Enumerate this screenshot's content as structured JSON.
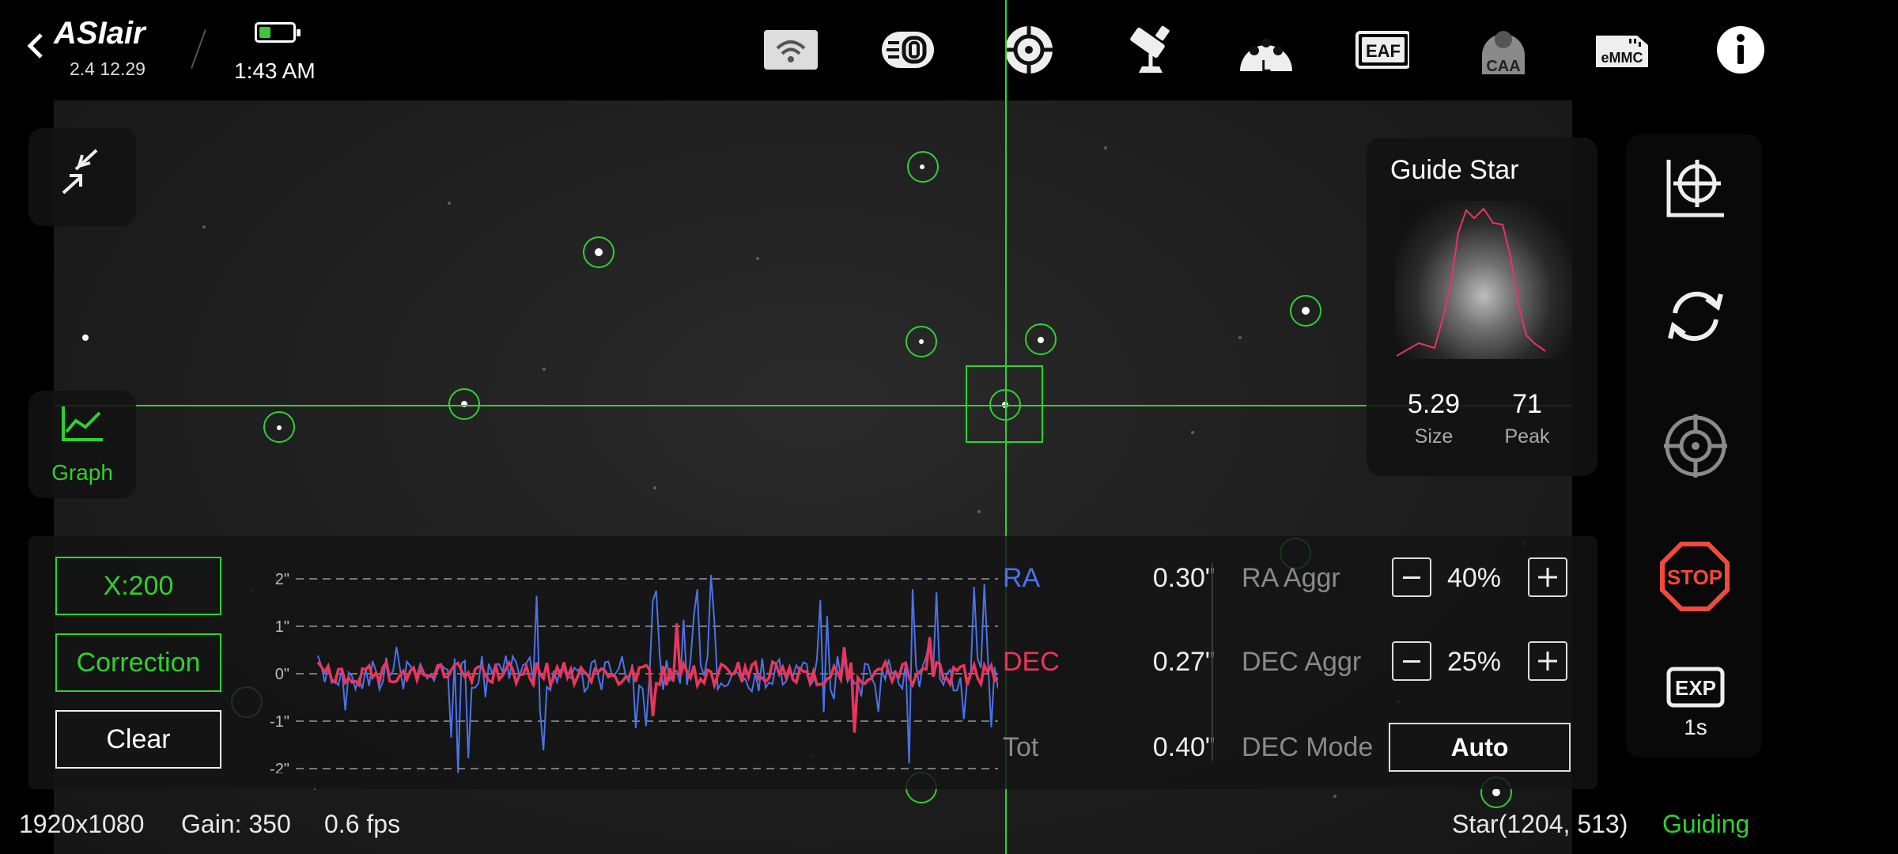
{
  "app": {
    "logo": "ASIair",
    "version": "2.4 12.29",
    "time": "1:43 AM"
  },
  "topbar": {
    "icons": [
      "wifi-icon",
      "storage-icon",
      "guide-target-icon",
      "telescope-icon",
      "filter-wheel-icon",
      "eaf-icon",
      "caa-icon",
      "emmc-icon",
      "info-icon"
    ],
    "eaf_label": "EAF",
    "caa_label": "CAA",
    "emmc_label": "eMMC",
    "filter_label": "L"
  },
  "left": {
    "graph_label": "Graph"
  },
  "guide_star": {
    "title": "Guide Star",
    "size_value": "5.29",
    "size_label": "Size",
    "peak_value": "71",
    "peak_label": "Peak"
  },
  "graph": {
    "x_button": "X:200",
    "correction_button": "Correction",
    "clear_button": "Clear",
    "y_ticks": [
      "2\"",
      "1\"",
      "0\"",
      "-1\"",
      "-2\""
    ],
    "ra_color": "#4a73e8",
    "dec_color": "#e8365c"
  },
  "stats": {
    "ra_label": "RA",
    "ra_value": "0.30\"",
    "dec_label": "DEC",
    "dec_value": "0.27\"",
    "tot_label": "Tot",
    "tot_value": "0.40\"",
    "ra_aggr_label": "RA Aggr",
    "ra_aggr_value": "40%",
    "dec_aggr_label": "DEC Aggr",
    "dec_aggr_value": "25%",
    "dec_mode_label": "DEC Mode",
    "dec_mode_value": "Auto"
  },
  "right": {
    "stop_label": "STOP",
    "exp_label": "EXP",
    "exp_value": "1s"
  },
  "status": {
    "resolution": "1920x1080",
    "gain": "Gain: 350",
    "fps": "0.6 fps",
    "star": "Star(1204, 513)",
    "state": "Guiding"
  },
  "colors": {
    "accent": "#2fd12f",
    "stop": "#f04a3c"
  }
}
